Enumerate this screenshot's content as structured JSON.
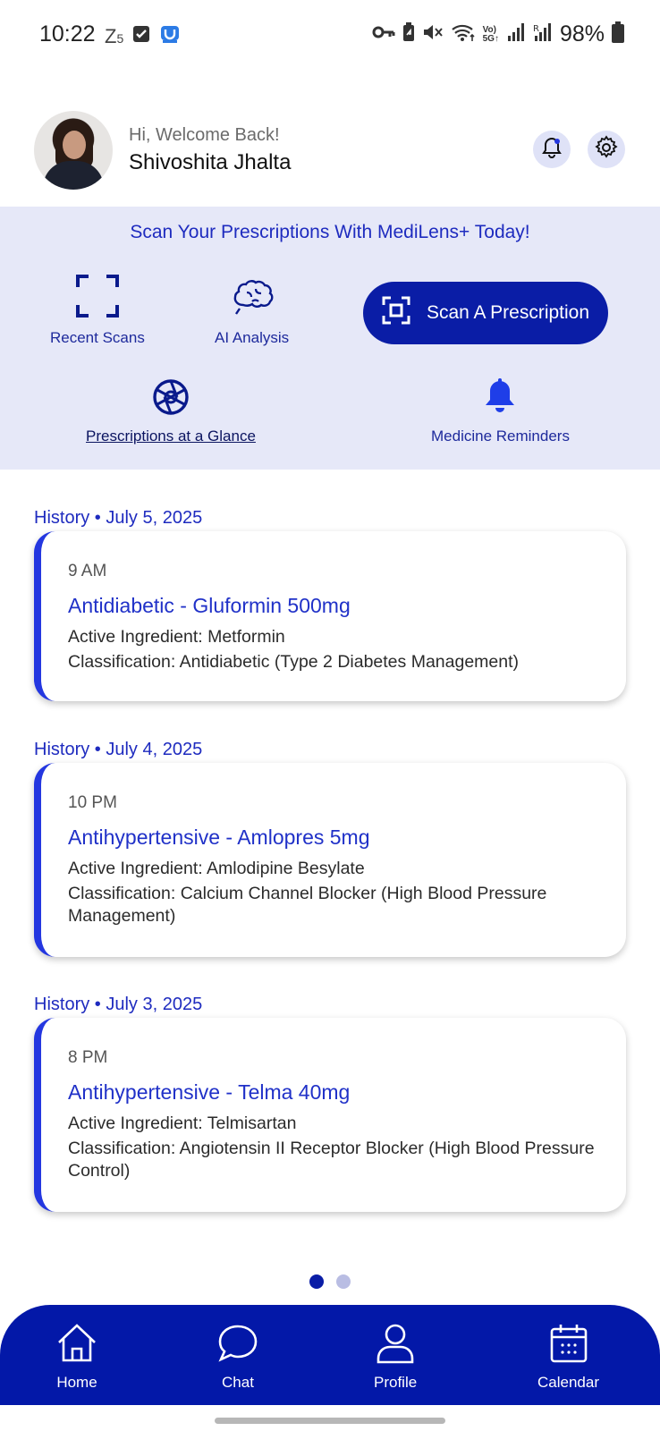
{
  "status_bar": {
    "time": "10:22",
    "battery": "98%",
    "left_icons": [
      "z5-icon",
      "checkbox-icon",
      "app-badge-icon"
    ],
    "right_icons": [
      "key-icon",
      "battery-saver-icon",
      "mute-icon",
      "wifi-icon",
      "volte-icon",
      "signal-icon",
      "signal-roaming-icon",
      "battery-icon"
    ]
  },
  "header": {
    "greeting": "Hi, Welcome Back!",
    "user_name": "Shivoshita Jhalta",
    "icons": [
      "bell-icon",
      "gear-icon"
    ]
  },
  "panel": {
    "title": "Scan Your Prescriptions With MediLens+ Today!",
    "recent_scans": "Recent Scans",
    "ai_analysis": "AI Analysis",
    "scan_button": "Scan A Prescription",
    "prescriptions_glance": "Prescriptions at a Glance",
    "medicine_reminders": "Medicine Reminders"
  },
  "history": [
    {
      "header": "History • July 5, 2025",
      "time": "9 AM",
      "title": "Antidiabetic - Gluformin 500mg",
      "ingredient": "Active Ingredient: Metformin",
      "classification": "Classification: Antidiabetic (Type 2 Diabetes Management)"
    },
    {
      "header": "History • July 4, 2025",
      "time": "10 PM",
      "title": "Antihypertensive - Amlopres 5mg",
      "ingredient": "Active Ingredient: Amlodipine Besylate",
      "classification": "Classification: Calcium Channel Blocker (High Blood Pressure Management)"
    },
    {
      "header": "History • July 3, 2025",
      "time": "8 PM",
      "title": "Antihypertensive - Telma 40mg",
      "ingredient": "Active Ingredient: Telmisartan",
      "classification": "Classification: Angiotensin II Receptor Blocker (High Blood Pressure Control)"
    }
  ],
  "pager": {
    "pages": 2,
    "active": 1
  },
  "bottom_nav": {
    "home": "Home",
    "chat": "Chat",
    "profile": "Profile",
    "calendar": "Calendar"
  },
  "colors": {
    "primary": "#0a1da6",
    "accent_text": "#1e2bbf",
    "panel_bg": "#e6e8f8",
    "card_border": "#2437e0"
  }
}
